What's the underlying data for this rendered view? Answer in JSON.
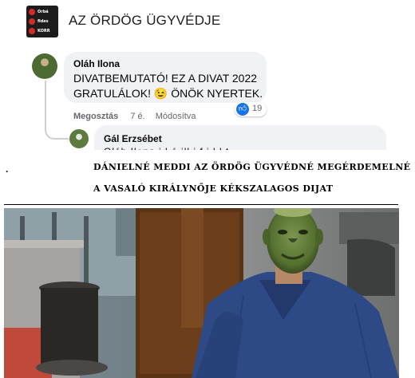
{
  "group": {
    "logo_lines": [
      "Orbá",
      "fides",
      "KORR"
    ],
    "title": "AZ ÖRDÖG ÜGYVÉDJE"
  },
  "comment1": {
    "author": "Oláh Ilona",
    "text": "DIVATBEMUTATÓ! EZ A DIVAT 2022 GRATULÁLOK! 😉 ÖNÖK NYERTEK.",
    "reaction_count": "19",
    "reaction_icon": "like-icon",
    "actions": {
      "share": "Megosztás",
      "time": "7 é.",
      "edit": "Módosítva"
    }
  },
  "comment2": {
    "author": "Gál Erzsébet",
    "text_cut": "Oláh Ilona    i  l    á    ill   i            f  i   l     l     t"
  },
  "caption": {
    "dot": ".",
    "line1": "DÁNIELNÉ MEDDI AZ ÖRDÖG ÜGYVÉDNÉ MEGÉRDEMELNÉ",
    "line2": "A VASALÓ KIRÁLYNŐJE KÉKSZALAGOS DIJAT"
  },
  "colors": {
    "facebook_blue": "#1b74e4",
    "shirt_blue": "#2d4a86",
    "mask_green": "#5f7a3c"
  }
}
